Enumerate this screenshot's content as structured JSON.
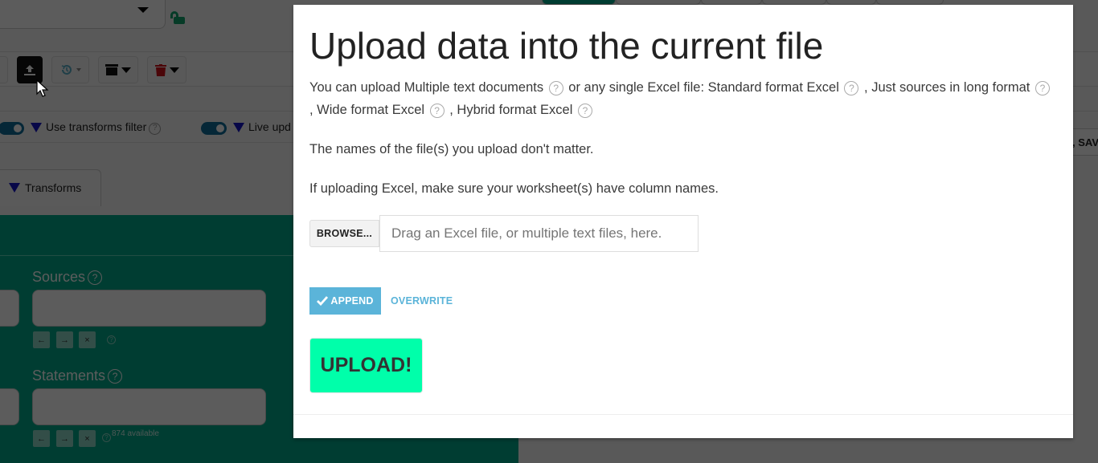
{
  "background": {
    "toolbar": {
      "upload_button_icon": "upload-icon",
      "history_button_icon": "history-icon",
      "archive_button_icon": "archive-box-icon",
      "delete_button_icon": "trash-icon"
    },
    "filters": {
      "use_transforms_filter": "Use transforms filter",
      "live_update": "Live upd"
    },
    "tabs": {
      "transforms": "Transforms"
    },
    "fields": {
      "sources_label": "Sources",
      "statements_label": "Statements",
      "statements_available": "874 available",
      "nav_prev": "←",
      "nav_next": "→",
      "nav_clear": "×"
    },
    "right_edge_label": ", SAV",
    "colors": {
      "panel_green": "#00a88a",
      "lock_green": "#12a56c",
      "funnel_blue": "#1515c8",
      "toggle_blue": "#0f6e9a",
      "trash_red": "#d0121b"
    }
  },
  "modal": {
    "title": "Upload data into the current file",
    "intro": {
      "part1": "You can upload Multiple text documents",
      "part2": "or any single Excel file: Standard format Excel",
      "part3": ", Just sources in long format",
      "part4": ", Wide format Excel",
      "part5": ", Hybrid format Excel"
    },
    "note_names": "The names of the file(s) you upload don't matter.",
    "note_excel": "If uploading Excel, make sure your worksheet(s) have column names.",
    "browse_label": "BROWSE...",
    "drop_placeholder": "Drag an Excel file, or multiple text files, here.",
    "mode": {
      "append_label": "APPEND",
      "overwrite_label": "OVERWRITE",
      "selected": "APPEND"
    },
    "upload_label": "UPLOAD!",
    "help_glyph": "?",
    "colors": {
      "append_bg": "#5bb4d9",
      "upload_bg": "#00ffaa"
    }
  }
}
